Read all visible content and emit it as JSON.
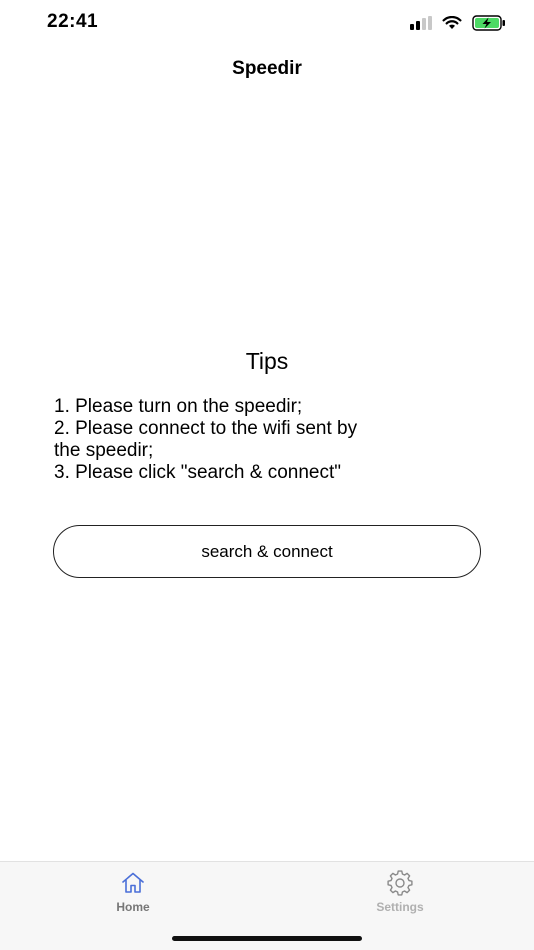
{
  "status_bar": {
    "time": "22:41",
    "icons": [
      "cellular-signal-icon",
      "wifi-icon",
      "battery-charging-icon"
    ]
  },
  "nav": {
    "title": "Speedir"
  },
  "tips": {
    "title": "Tips",
    "lines": [
      "1. Please turn on the speedir;",
      "2. Please connect to the wifi sent by",
      "the speedir;",
      "3. Please click \"search & connect\""
    ]
  },
  "actions": {
    "connect_label": "search & connect"
  },
  "tab_bar": {
    "items": [
      {
        "label": "Home",
        "icon": "home-icon",
        "active": true
      },
      {
        "label": "Settings",
        "icon": "gear-icon",
        "active": false
      }
    ]
  },
  "colors": {
    "active_tab_icon": "#4a6fd8",
    "inactive_tab": "#b0b0b0",
    "battery_fill": "#4cd964"
  }
}
